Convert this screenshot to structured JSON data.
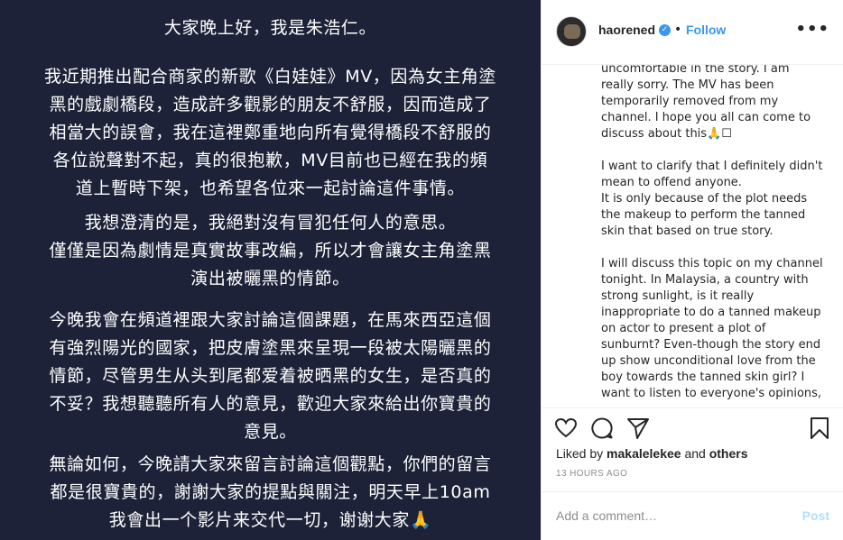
{
  "post_image": {
    "paragraphs": [
      [
        "大家晚上好，我是朱浩仁。"
      ],
      [
        "我近期推出配合商家的新歌《白娃娃》MV，因為女主角塗",
        "黑的戲劇橋段，造成許多觀影的朋友不舒服，因而造成了",
        "相當大的誤會，我在這裡鄭重地向所有覺得橋段不舒服的",
        "各位說聲對不起，真的很抱歉，MV目前也已經在我的頻",
        "道上暫時下架，也希望各位來一起討論這件事情。"
      ],
      [
        "我想澄清的是，我絕對沒有冒犯任何人的意思。",
        "僅僅是因為劇情是真實故事改編，所以才會讓女主角塗黑",
        "演出被曬黑的情節。"
      ],
      [
        "今晚我會在頻道裡跟大家討論這個課題，在馬來西亞這個",
        "有強烈陽光的國家，把皮膚塗黑來呈現一段被太陽曬黑的",
        "情節，尽管男生从头到尾都爱着被晒黑的女生，是否真的",
        "不妥？我想聽聽所有人的意見，歡迎大家來給出你寶貴的",
        "意見。"
      ],
      [
        "無論如何，今晚請大家來留言討論這個觀點，你們的留言",
        "都是很寶貴的，謝謝大家的提點與關注，明天早上10am",
        "我會出一个影片来交代一切，谢谢大家🙏"
      ]
    ]
  },
  "header": {
    "username": "haorened",
    "separator": "•",
    "follow_label": "Follow",
    "more_label": "•••"
  },
  "caption": {
    "lines": [
      "uncomfortable in the story. I am",
      "really sorry. The MV has been",
      "temporarily removed from my",
      "channel. I hope you all can come to",
      "discuss about this🙏☐",
      "",
      "I want to clarify that I definitely didn't",
      "mean to offend anyone.",
      "It is only because of the plot needs",
      "the makeup to perform the tanned",
      "skin that based on true story.",
      "",
      "I will discuss this topic on my channel",
      "tonight. In Malaysia, a country with",
      "strong sunlight, is it really",
      "inappropriate to do a tanned makeup",
      "on actor to present a plot of",
      "sunburnt? Even-though the story end",
      "up show unconditional love from the",
      "boy towards the tanned skin girl? I",
      "want to listen to everyone's opinions,"
    ]
  },
  "likes": {
    "prefix": "Liked by ",
    "user": "makalelekee",
    "middle": " and ",
    "others": "others"
  },
  "timestamp": "13 HOURS AGO",
  "comment": {
    "placeholder": "Add a comment…",
    "post_label": "Post"
  },
  "icons": {
    "like": "heart-icon",
    "comment": "comment-bubble-icon",
    "share": "paper-plane-icon",
    "save": "bookmark-icon",
    "verified": "verified-badge-icon"
  },
  "colors": {
    "image_background": "#1d2238",
    "accent": "#3897f0",
    "post_disabled": "#b2dffc",
    "muted": "#8e8e8e"
  }
}
